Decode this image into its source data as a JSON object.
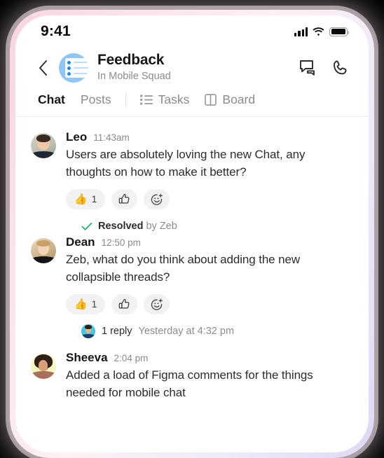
{
  "status_bar": {
    "time": "9:41",
    "icons": [
      "cellular-signal-icon",
      "wifi-icon",
      "battery-icon"
    ]
  },
  "header": {
    "back_icon": "chevron-left-icon",
    "avatar_icon": "group-list-avatar",
    "title": "Feedback",
    "subtitle": "In Mobile Squad",
    "actions": [
      {
        "name": "threads-icon",
        "label": "Threads"
      },
      {
        "name": "call-icon",
        "label": "Call"
      }
    ]
  },
  "tabs": [
    {
      "label": "Chat",
      "active": true,
      "icon": null
    },
    {
      "label": "Posts",
      "active": false,
      "icon": null
    },
    {
      "label": "Tasks",
      "active": false,
      "icon": "list-icon"
    },
    {
      "label": "Board",
      "active": false,
      "icon": "board-icon"
    }
  ],
  "messages": [
    {
      "author": "Leo",
      "time": "11:43am",
      "text": "Users are absolutely loving the new Chat, any thoughts on how to make it better?",
      "reactions": {
        "emoji": "👍",
        "count": "1",
        "add_label": "add-reaction"
      }
    },
    {
      "resolved": {
        "label": "Resolved",
        "by": "by Zeb"
      },
      "author": "Dean",
      "time": "12:50 pm",
      "text": "Zeb, what do you think about adding the new collapsible threads?",
      "reactions": {
        "emoji": "👍",
        "count": "1",
        "add_label": "add-reaction"
      },
      "thread": {
        "count": "1 reply",
        "time": "Yesterday at 4:32 pm"
      }
    },
    {
      "author": "Sheeva",
      "time": "2:04 pm",
      "text": "Added a load of Figma comments for the things needed for mobile chat"
    }
  ],
  "colors": {
    "accent_blue": "#8fc6f5",
    "resolved_green": "#2bb673",
    "text_primary": "#15161a",
    "text_secondary": "#8a8b91",
    "pill_bg": "#f2f2f3",
    "frame_pink": "#f7d5e2",
    "frame_lavender": "#ddd9f4"
  }
}
